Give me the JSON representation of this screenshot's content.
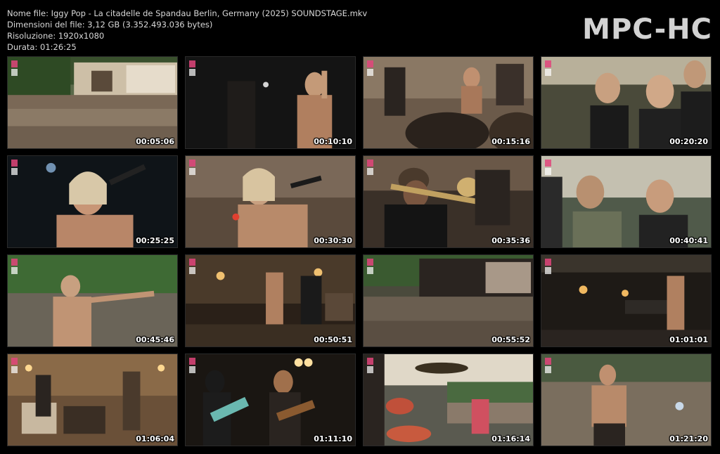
{
  "header": {
    "filename_line": "Nome file: Iggy Pop - La citadelle de Spandau Berlin, Germany (2025) SOUNDSTAGE.mkv",
    "size_line": "Dimensioni del file: 3,12 GB (3.352.493.036 bytes)",
    "resolution_line": "Risoluzione: 1920x1080",
    "duration_line": "Durata: 01:26:25",
    "logo": "MPC-HC"
  },
  "thumbnails": [
    {
      "time": "00:05:06",
      "scene": "wide crowd and stage under trees"
    },
    {
      "time": "00:10:10",
      "scene": "dark stage, shirtless singer with microphone"
    },
    {
      "time": "00:15:16",
      "scene": "band on stage behind crowd heads"
    },
    {
      "time": "00:20:20",
      "scene": "audience close-up"
    },
    {
      "time": "00:25:25",
      "scene": "singer close-up with microphone, dark background"
    },
    {
      "time": "00:30:30",
      "scene": "singer with microphone, warm light"
    },
    {
      "time": "00:35:36",
      "scene": "trumpet player"
    },
    {
      "time": "00:40:41",
      "scene": "audience members singing"
    },
    {
      "time": "00:45:46",
      "scene": "singer facing crowd, trees"
    },
    {
      "time": "00:50:51",
      "scene": "band on stage, warm lights"
    },
    {
      "time": "00:55:52",
      "scene": "wide crowd, stage"
    },
    {
      "time": "01:01:01",
      "scene": "stage with keyboards and singer"
    },
    {
      "time": "01:06:04",
      "scene": "stage with amplifiers, warm light"
    },
    {
      "time": "01:11:10",
      "scene": "two guitarists"
    },
    {
      "time": "01:16:14",
      "scene": "drum kit and crowd, daylight"
    },
    {
      "time": "01:21:20",
      "scene": "singer from behind facing crowd"
    }
  ],
  "colors": {
    "background": "#000000",
    "text": "#d8d8d8",
    "logo": "#d2d2d2",
    "badge": "#e0457b"
  }
}
